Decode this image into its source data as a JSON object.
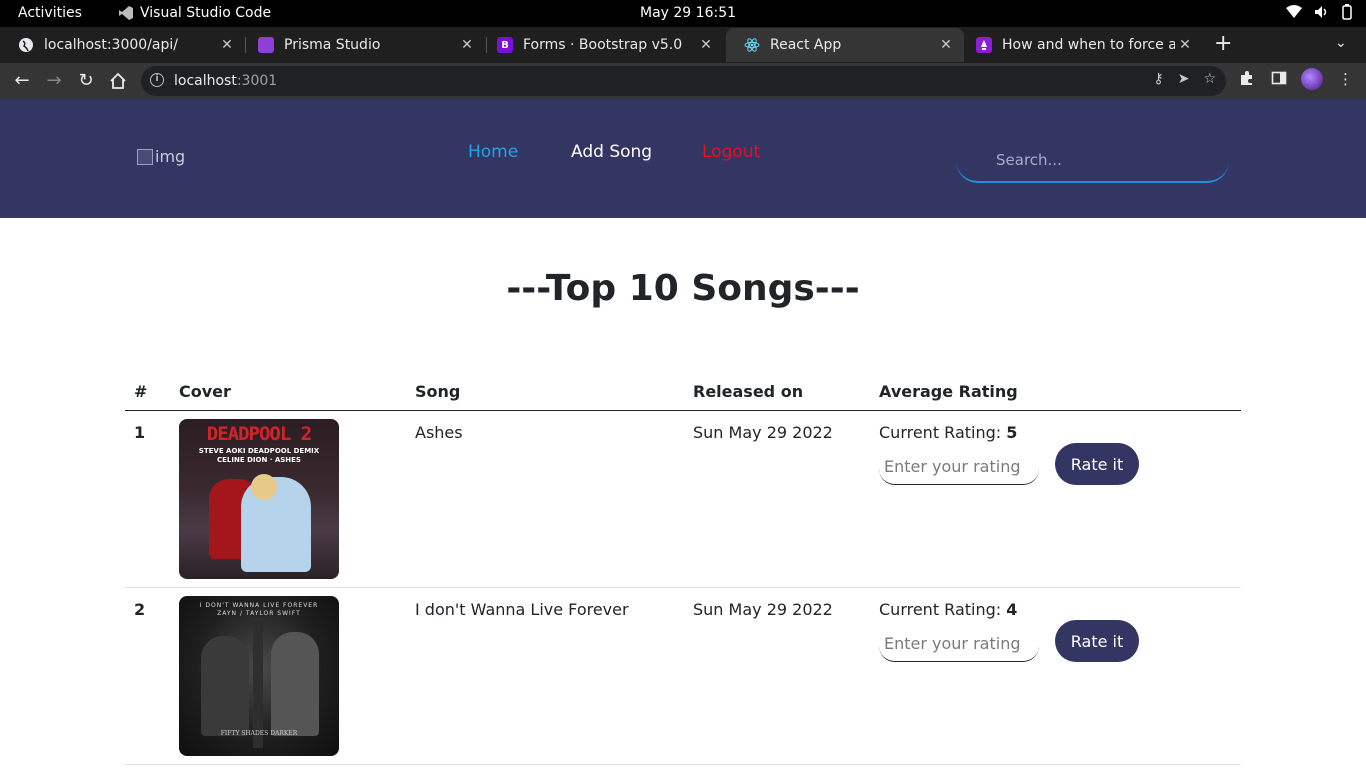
{
  "system": {
    "activities": "Activities",
    "app_name": "Visual Studio Code",
    "clock": "May 29  16:51"
  },
  "browser": {
    "tabs": [
      {
        "title": "localhost:3000/api/",
        "icon": "globe-icon"
      },
      {
        "title": "Prisma Studio",
        "icon": "prisma-icon"
      },
      {
        "title": "Forms · Bootstrap v5.0",
        "icon": "bootstrap-icon",
        "icon_glyph": "B"
      },
      {
        "title": "React App",
        "icon": "react-icon"
      },
      {
        "title": "How and when to force a",
        "icon": "tab-favicon"
      }
    ],
    "url_host": "localhost",
    "url_port": ":3001"
  },
  "header": {
    "logo_alt": "img",
    "nav": {
      "home": "Home",
      "add_song": "Add Song",
      "logout": "Logout"
    },
    "search_placeholder": "Search..."
  },
  "main": {
    "title": "---Top 10 Songs---",
    "columns": [
      "#",
      "Cover",
      "Song",
      "Released on",
      "Average Rating"
    ],
    "rating_prefix": "Current Rating: ",
    "rating_placeholder": "Enter your rating",
    "rate_button": "Rate it",
    "songs": [
      {
        "rank": "1",
        "name": "Ashes",
        "released": "Sun May 29 2022",
        "rating": "5",
        "cover_title": "DEADPOOL 2",
        "cover_subtitle": "STEVE AOKI DEADPOOL DEMIX",
        "cover_artists": "CELINE DION · ASHES"
      },
      {
        "rank": "2",
        "name": "I don't Wanna Live Forever",
        "released": "Sun May 29 2022",
        "rating": "4",
        "cover_title": "I DON'T WANNA LIVE FOREVER",
        "cover_artists": "ZAYN / TAYLOR SWIFT",
        "cover_footer": "FIFTY SHADES DARKER"
      }
    ]
  },
  "colors": {
    "header_bg": "#333562",
    "nav_home": "#20a4e8",
    "nav_logout": "#e8101c",
    "button_bg": "#333562"
  }
}
